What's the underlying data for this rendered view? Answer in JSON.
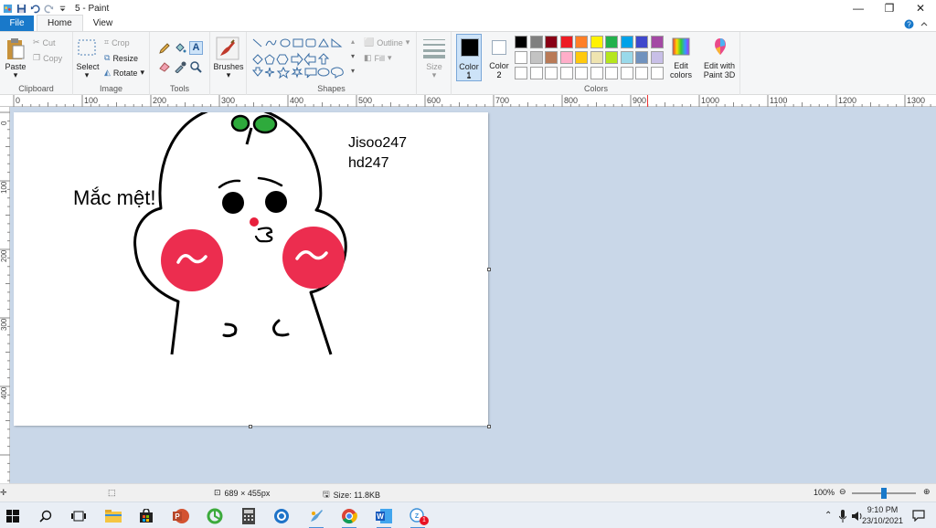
{
  "window": {
    "title": "5 - Paint",
    "minimize": "—",
    "maximize": "❐",
    "close": "✕"
  },
  "tabs": {
    "file": "File",
    "home": "Home",
    "view": "View"
  },
  "ribbon": {
    "clipboard": {
      "label": "Clipboard",
      "paste": "Paste",
      "cut": "Cut",
      "copy": "Copy"
    },
    "image": {
      "label": "Image",
      "select": "Select",
      "crop": "Crop",
      "resize": "Resize",
      "rotate": "Rotate"
    },
    "tools": {
      "label": "Tools"
    },
    "brushes": {
      "label": "Brushes"
    },
    "shapes": {
      "label": "Shapes",
      "outline": "Outline",
      "fill": "Fill"
    },
    "size": {
      "label": "Size"
    },
    "colors": {
      "label": "Colors",
      "color1": "Color 1",
      "color1_num": "1",
      "color2": "Color 2",
      "color2_num": "2",
      "edit_colors": "Edit colors",
      "edit_paint3d": "Edit with Paint 3D",
      "palette_row1": [
        "#000000",
        "#7f7f7f",
        "#880015",
        "#ed1c24",
        "#ff7f27",
        "#fff200",
        "#22b14c",
        "#00a2e8",
        "#3f48cc",
        "#a349a4"
      ],
      "palette_row2": [
        "#ffffff",
        "#c3c3c3",
        "#b97a57",
        "#ffaec9",
        "#ffc90e",
        "#efe4b0",
        "#b5e61d",
        "#99d9ea",
        "#7092be",
        "#c8bfe7"
      ],
      "color1_value": "#000000",
      "color2_value": "#ffffff"
    }
  },
  "ruler": {
    "h_labels": [
      "0",
      "100",
      "200",
      "300",
      "400",
      "500",
      "600",
      "700",
      "800",
      "900",
      "1000",
      "1100",
      "1200",
      "1300"
    ],
    "v_labels": [
      "0",
      "100",
      "200",
      "300",
      "400"
    ]
  },
  "canvas": {
    "text_main": "Mắc mệt!",
    "text_line1": "Jisoo247",
    "text_line2": "hd247"
  },
  "status": {
    "dimensions": "689 × 455px",
    "size": "Size: 11.8KB",
    "zoom": "100%",
    "zoom_fraction": 0.5
  },
  "taskbar": {
    "time": "9:10 PM",
    "date": "23/10/2021",
    "badge": "1"
  }
}
